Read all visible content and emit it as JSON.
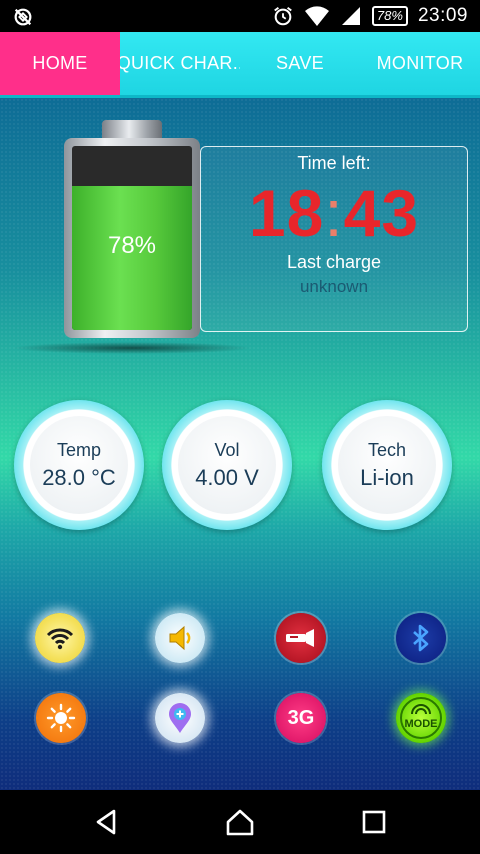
{
  "status_bar": {
    "battery_percent": "78%",
    "time": "23:09",
    "icons": [
      "no-sync-icon",
      "alarm-icon",
      "wifi-icon",
      "signal-icon"
    ]
  },
  "tabs": [
    {
      "label": "HOME",
      "active": true
    },
    {
      "label": "QUICK CHAR..",
      "active": false
    },
    {
      "label": "SAVE",
      "active": false
    },
    {
      "label": "MONITOR",
      "active": false
    }
  ],
  "battery": {
    "level_percent": 78,
    "level_text": "78%"
  },
  "info": {
    "time_left_label": "Time left:",
    "hours": "18",
    "colon": ":",
    "minutes": "43",
    "last_charge_label": "Last charge",
    "last_charge_value": "unknown"
  },
  "gauges": {
    "temp": {
      "label": "Temp",
      "value": "28.0 °C"
    },
    "vol": {
      "label": "Vol",
      "value": "4.00 V"
    },
    "tech": {
      "label": "Tech",
      "value": "Li-ion"
    }
  },
  "toggles": {
    "row1": [
      "wifi-toggle",
      "sound-toggle",
      "flashlight-toggle",
      "bluetooth-toggle"
    ],
    "row2": [
      "brightness-toggle",
      "gps-toggle",
      "mobile-data-toggle",
      "mode-toggle"
    ],
    "mobile_data_label": "3G",
    "mode_label": "MODE"
  },
  "colors": {
    "tab_active": "#ff2f8a",
    "tab_bar": "#22d8e6",
    "time_left": "#e8262b",
    "battery_fill": "#56c93b"
  },
  "nav": [
    "back-icon",
    "home-icon",
    "recents-icon"
  ]
}
